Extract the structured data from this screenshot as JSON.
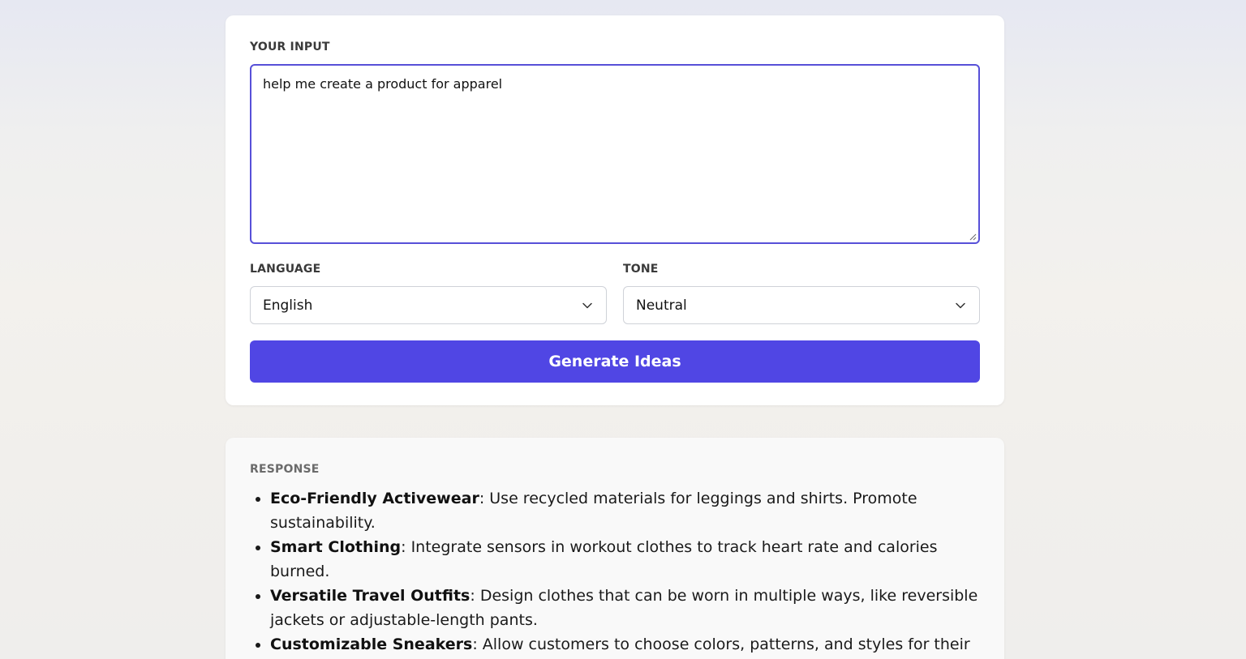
{
  "input": {
    "label": "YOUR INPUT",
    "value": "help me create a product for apparel"
  },
  "language": {
    "label": "LANGUAGE",
    "selected": "English"
  },
  "tone": {
    "label": "TONE",
    "selected": "Neutral"
  },
  "generate_button": {
    "label": "Generate Ideas"
  },
  "response": {
    "label": "RESPONSE",
    "items": [
      {
        "title": "Eco-Friendly Activewear",
        "text": ": Use recycled materials for leggings and shirts. Promote sustainability."
      },
      {
        "title": "Smart Clothing",
        "text": ": Integrate sensors in workout clothes to track heart rate and calories burned."
      },
      {
        "title": "Versatile Travel Outfits",
        "text": ": Design clothes that can be worn in multiple ways, like reversible jackets or adjustable-length pants."
      },
      {
        "title": "Customizable Sneakers",
        "text": ": Allow customers to choose colors, patterns, and styles for their shoes."
      }
    ]
  },
  "colors": {
    "accent": "#5046e4",
    "focus_border": "#5750d8"
  }
}
